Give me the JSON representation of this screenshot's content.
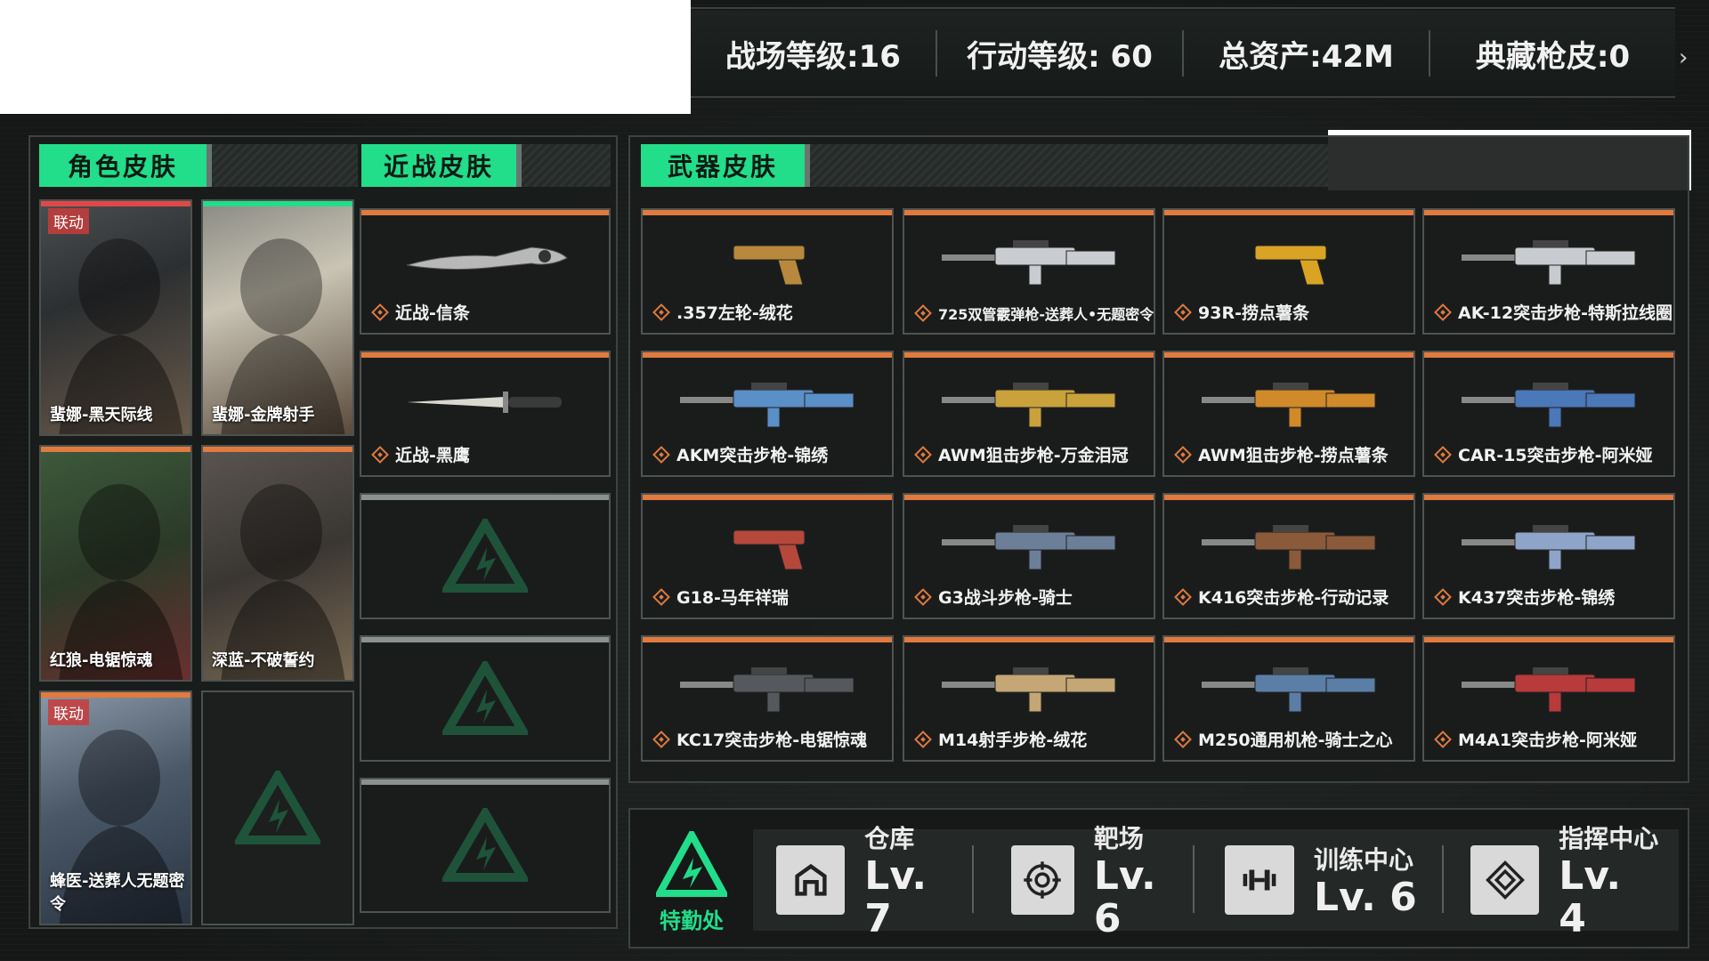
{
  "stats": {
    "battlefield_level": "战场等级:16",
    "operation_level": "行动等级: 60",
    "total_assets": "总资产:42M",
    "collection_skins": "典藏枪皮:0"
  },
  "panels": {
    "character_title": "角色皮肤",
    "melee_title": "近战皮肤",
    "weapon_title": "武器皮肤"
  },
  "characters": [
    {
      "label": "蜚娜-黑天际线",
      "badge": "联动"
    },
    {
      "label": "蜚娜-金牌射手",
      "badge": ""
    },
    {
      "label": "红狼-电锯惊魂",
      "badge": ""
    },
    {
      "label": "深蓝-不破誓约",
      "badge": ""
    },
    {
      "label": "蜂医-送葬人无题密令",
      "badge": "联动"
    }
  ],
  "melee": [
    {
      "label": "近战-信条"
    },
    {
      "label": "近战-黑鹰"
    }
  ],
  "weapons": [
    {
      "label": ".357左轮-绒花",
      "color": "#b8893c"
    },
    {
      "label": "725双管霰弹枪-送葬人•无题密令",
      "color": "#c9ccd0"
    },
    {
      "label": "93R-捞点薯条",
      "color": "#d9a423"
    },
    {
      "label": "AK-12突击步枪-特斯拉线圈",
      "color": "#c8ccd0"
    },
    {
      "label": "AKM突击步枪-锦绣",
      "color": "#5a8fc8"
    },
    {
      "label": "AWM狙击步枪-万金泪冠",
      "color": "#c9a23c"
    },
    {
      "label": "AWM狙击步枪-捞点薯条",
      "color": "#d08a2a"
    },
    {
      "label": "CAR-15突击步枪-阿米娅",
      "color": "#4a78b8"
    },
    {
      "label": "G18-马年祥瑞",
      "color": "#b5483a"
    },
    {
      "label": "G3战斗步枪-骑士",
      "color": "#6b7f99"
    },
    {
      "label": "K416突击步枪-行动记录",
      "color": "#8a5a3a"
    },
    {
      "label": "K437突击步枪-锦绣",
      "color": "#8ea4c8"
    },
    {
      "label": "KC17突击步枪-电锯惊魂",
      "color": "#55595e"
    },
    {
      "label": "M14射手步枪-绒花",
      "color": "#c4a775"
    },
    {
      "label": "M250通用机枪-骑士之心",
      "color": "#5a7ea6"
    },
    {
      "label": "M4A1突击步枪-阿米娅",
      "color": "#b83a3a"
    }
  ],
  "facilities": {
    "logo_text": "特勤处",
    "items": [
      {
        "name": "仓库",
        "level": "Lv. 7",
        "icon": "warehouse-icon"
      },
      {
        "name": "靶场",
        "level": "Lv. 6",
        "icon": "target-icon"
      },
      {
        "name": "训练中心",
        "level": "Lv. 6",
        "icon": "dumbbell-icon"
      },
      {
        "name": "指挥中心",
        "level": "Lv. 4",
        "icon": "command-icon"
      }
    ]
  },
  "colors": {
    "accent_green": "#22dd8a",
    "rarity_orange": "#e07a3e"
  }
}
